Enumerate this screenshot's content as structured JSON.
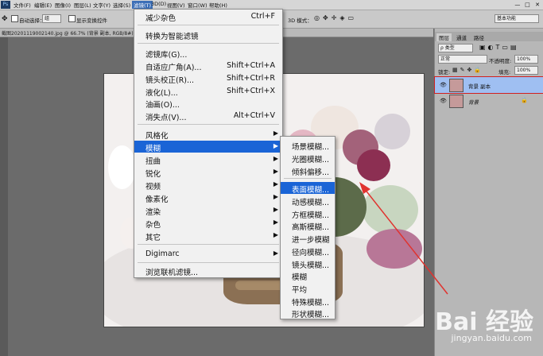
{
  "menubar": {
    "logo": "Ps",
    "items": [
      "文件(F)",
      "编辑(E)",
      "图像(I)",
      "图层(L)",
      "文字(Y)",
      "选择(S)",
      "滤镜(T)",
      "3D(D)",
      "视图(V)",
      "窗口(W)",
      "帮助(H)"
    ],
    "window_controls": [
      "—",
      "□",
      "✕"
    ]
  },
  "options": {
    "auto_select": "自动选择：",
    "auto_select_value": "组",
    "show_transform": "显示变换控件",
    "mode_3d": "3D 模式：",
    "workspace": "基本功能"
  },
  "document": {
    "tab_title": "截图20201119002140.jpg @ 66.7% (背景 副本, RGB/8#)"
  },
  "filter_menu": {
    "items": [
      {
        "label": "减少杂色",
        "shortcut": "Ctrl+F"
      },
      {
        "label": "转换为智能滤镜"
      },
      {
        "label": "滤镜库(G)..."
      },
      {
        "label": "自适应广角(A)...",
        "shortcut": "Shift+Ctrl+A"
      },
      {
        "label": "镜头校正(R)...",
        "shortcut": "Shift+Ctrl+R"
      },
      {
        "label": "液化(L)...",
        "shortcut": "Shift+Ctrl+X"
      },
      {
        "label": "油画(O)..."
      },
      {
        "label": "消失点(V)...",
        "shortcut": "Alt+Ctrl+V"
      },
      {
        "label": "风格化"
      },
      {
        "label": "模糊"
      },
      {
        "label": "扭曲"
      },
      {
        "label": "锐化"
      },
      {
        "label": "视频"
      },
      {
        "label": "像素化"
      },
      {
        "label": "渲染"
      },
      {
        "label": "杂色"
      },
      {
        "label": "其它"
      },
      {
        "label": "Digimarc"
      },
      {
        "label": "浏览联机滤镜..."
      }
    ]
  },
  "blur_submenu": {
    "items": [
      "场景模糊...",
      "光圈模糊...",
      "倾斜偏移...",
      "表面模糊...",
      "动感模糊...",
      "方框模糊...",
      "高斯模糊...",
      "进一步模糊",
      "径向模糊...",
      "镜头模糊...",
      "模糊",
      "平均",
      "特殊模糊...",
      "形状模糊..."
    ],
    "highlighted_index": 3
  },
  "layers_panel": {
    "tabs": [
      "图层",
      "通道",
      "路径"
    ],
    "kind_label": "ρ 类型",
    "blend_mode": "正常",
    "opacity_label": "不透明度:",
    "opacity_value": "100%",
    "lock_label": "锁定:",
    "fill_label": "填充:",
    "fill_value": "100%",
    "layers": [
      {
        "name": "背景 副本",
        "selected": true
      },
      {
        "name": "背景",
        "selected": false,
        "locked": true
      }
    ]
  },
  "watermark": {
    "brand": "Bai 经验",
    "url": "jingyan.baidu.com"
  },
  "colors": {
    "highlight": "#1a64d6",
    "arrow": "#e0332f",
    "layer_selected": "#9fbff2"
  }
}
